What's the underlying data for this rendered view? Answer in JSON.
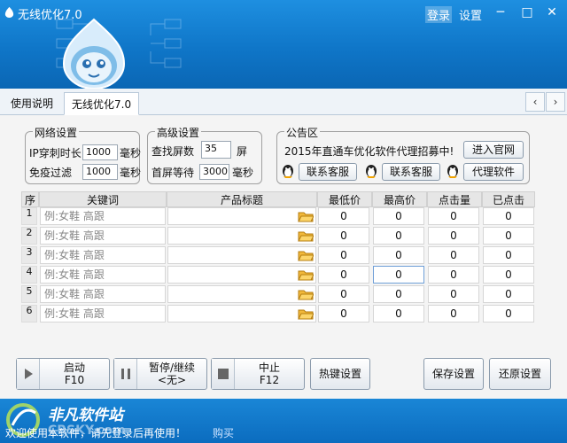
{
  "window": {
    "title": "无线优化7.0",
    "login": "登录",
    "settings": "设置",
    "minimize": "─",
    "maximize": "□",
    "close": "✕"
  },
  "tabs": [
    {
      "label": "使用说明"
    },
    {
      "label": "无线优化7.0"
    }
  ],
  "tab_nav": {
    "prev": "‹",
    "next": "›"
  },
  "network": {
    "title": "网络设置",
    "ip_label": "IP穿刺时长",
    "ip_value": "1000",
    "ip_unit": "毫秒",
    "captcha_label": "免疫过滤",
    "captcha_value": "1000",
    "captcha_unit": "毫秒"
  },
  "advanced": {
    "title": "高级设置",
    "screens_label": "查找屏数",
    "screens_value": "35",
    "screens_unit": "屏",
    "wait_label": "首屏等待",
    "wait_value": "3000",
    "wait_unit": "毫秒"
  },
  "notice": {
    "title": "公告区",
    "text": "2015年直通车优化软件代理招募中!",
    "website_button": "进入官网",
    "support1": "联系客服",
    "support2": "联系客服",
    "agent": "代理软件"
  },
  "table": {
    "headers": [
      "序",
      "关键词",
      "产品标题",
      "最低价",
      "最高价",
      "点击量",
      "已点击"
    ],
    "rows": [
      {
        "num": "1",
        "keyword": "例:女鞋 高跟",
        "title": "",
        "min": "0",
        "max": "0",
        "clicks": "0",
        "done": "0"
      },
      {
        "num": "2",
        "keyword": "例:女鞋 高跟",
        "title": "",
        "min": "0",
        "max": "0",
        "clicks": "0",
        "done": "0"
      },
      {
        "num": "3",
        "keyword": "例:女鞋 高跟",
        "title": "",
        "min": "0",
        "max": "0",
        "clicks": "0",
        "done": "0"
      },
      {
        "num": "4",
        "keyword": "例:女鞋 高跟",
        "title": "",
        "min": "0",
        "max": "0",
        "clicks": "0",
        "done": "0"
      },
      {
        "num": "5",
        "keyword": "例:女鞋 高跟",
        "title": "",
        "min": "0",
        "max": "0",
        "clicks": "0",
        "done": "0"
      },
      {
        "num": "6",
        "keyword": "例:女鞋 高跟",
        "title": "",
        "min": "0",
        "max": "0",
        "clicks": "0",
        "done": "0"
      }
    ]
  },
  "controls": {
    "start": {
      "label": "启动",
      "key": "F10"
    },
    "pause": {
      "label": "暂停/继续",
      "key": "<无>"
    },
    "stop": {
      "label": "中止",
      "key": "F12"
    },
    "hotkey": "热键设置",
    "save": "保存设置",
    "restore": "还原设置"
  },
  "status": {
    "message": "欢迎使用本软件，请先登录后再使用！",
    "buy": "购买"
  },
  "watermark": {
    "name": "非凡软件站",
    "url": "CRSKY.com"
  },
  "colors": {
    "header": "#1a86d6",
    "panel": "#f4f4f4",
    "placeholder": "#888888"
  }
}
